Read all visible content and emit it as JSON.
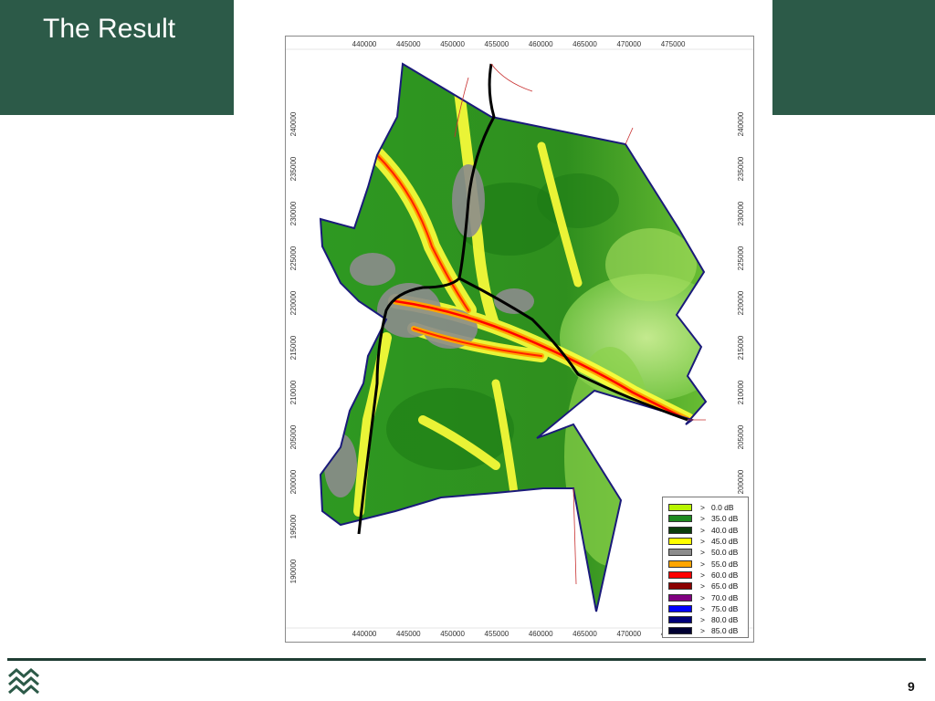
{
  "slide": {
    "title": "The Result",
    "page_number": "9",
    "colors": {
      "band": "#2c5a48",
      "footer_rule": "#1f3d33"
    }
  },
  "map": {
    "x_ticks": [
      "440000",
      "445000",
      "450000",
      "455000",
      "460000",
      "465000",
      "470000",
      "475000"
    ],
    "y_ticks": [
      "240000",
      "235000",
      "230000",
      "225000",
      "220000",
      "215000",
      "210000",
      "205000",
      "200000",
      "195000",
      "190000"
    ],
    "legend": [
      {
        "symbol": ">",
        "label": "0.0 dB",
        "color": "#b8f500"
      },
      {
        "symbol": ">",
        "label": "35.0 dB",
        "color": "#1e8a1e"
      },
      {
        "symbol": ">",
        "label": "40.0 dB",
        "color": "#0c3d0c"
      },
      {
        "symbol": ">",
        "label": "45.0 dB",
        "color": "#ffff00"
      },
      {
        "symbol": ">",
        "label": "50.0 dB",
        "color": "#8c8c8c"
      },
      {
        "symbol": ">",
        "label": "55.0 dB",
        "color": "#ffa500"
      },
      {
        "symbol": ">",
        "label": "60.0 dB",
        "color": "#ff0000"
      },
      {
        "symbol": ">",
        "label": "65.0 dB",
        "color": "#8b0000"
      },
      {
        "symbol": ">",
        "label": "70.0 dB",
        "color": "#800080"
      },
      {
        "symbol": ">",
        "label": "75.0 dB",
        "color": "#0000ff"
      },
      {
        "symbol": ">",
        "label": "80.0 dB",
        "color": "#00007a"
      },
      {
        "symbol": ">",
        "label": "85.0 dB",
        "color": "#000033"
      }
    ]
  }
}
